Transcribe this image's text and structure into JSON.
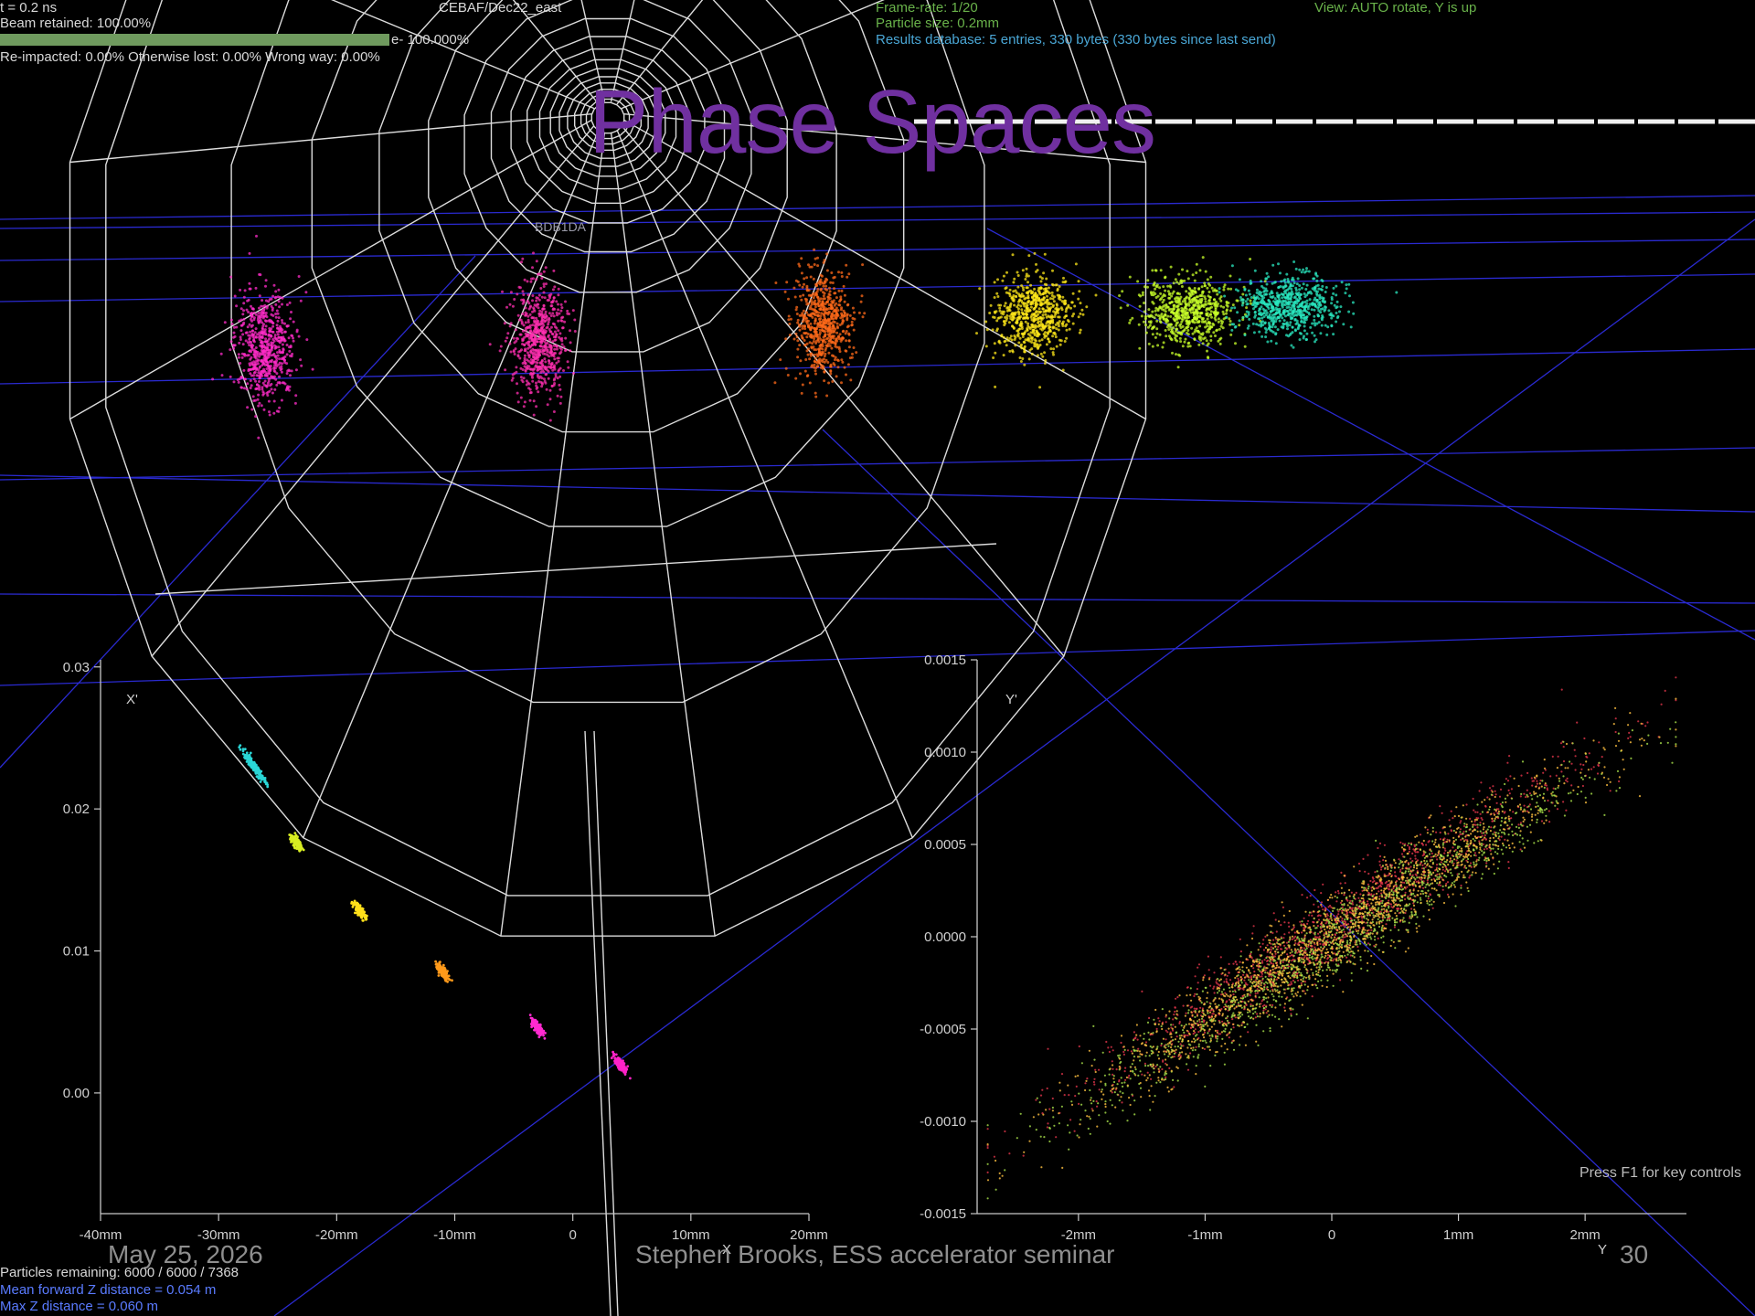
{
  "slide": {
    "title": "Phase Spaces",
    "date": "May 25, 2026",
    "presenter": "Stephen Brooks, ESS accelerator seminar",
    "page_number": "30"
  },
  "hud": {
    "time": "t = 0.2 ns",
    "beam_retained": "Beam retained: 100.00%",
    "beam_retained_fraction": 1.0,
    "electron_pct": "e- 100.000%",
    "loss_line": "Re-impacted: 0.00%   Otherwise lost: 0.00%   Wrong way: 0.00%",
    "lattice_name": "CEBAF/Dec22_east",
    "frame_rate": "Frame-rate: 1/20",
    "particle_size": "Particle size: 0.2mm",
    "results_db": "Results database: 5 entries, 330 bytes (330 bytes since last send)",
    "view": "View: AUTO rotate, Y is up",
    "element_label": "BDB1DA",
    "particles_remaining": "Particles remaining: 6000 / 6000 / 7368",
    "mean_z": "Mean forward Z distance = 0.054 m",
    "max_z": "Max Z distance = 0.060 m",
    "key_hint": "Press F1 for key controls"
  },
  "colors": {
    "title": "#7030a0",
    "hud_green": "#69b24a",
    "hud_cyan": "#4aa7d6",
    "hud_blue": "#5a7bff",
    "grid_blue": "#2a2ad0",
    "wireframe": "#e0e0e0",
    "bunches": [
      "#ff2cc8",
      "#ff2fb0",
      "#ff6a1a",
      "#ffe81a",
      "#c8ff2a",
      "#2ae8c0"
    ]
  },
  "chart_data": [
    {
      "type": "scatter",
      "xlabel": "X",
      "ylabel": "X'",
      "x_unit": "mm",
      "xlim": [
        -40,
        20
      ],
      "ylim": [
        -0.0085,
        0.0305
      ],
      "x_ticks": [
        -40,
        -30,
        -20,
        -10,
        0,
        10,
        20
      ],
      "x_tick_labels": [
        "-40mm",
        "-30mm",
        "-20mm",
        "-10mm",
        "0",
        "10mm",
        "20mm"
      ],
      "y_ticks": [
        0.0,
        0.01,
        0.02,
        0.03
      ],
      "y_tick_labels": [
        "0.00",
        "0.01",
        "0.02",
        "0.03"
      ],
      "series": [
        {
          "color": "#2ad6d6",
          "x": -27,
          "y": 0.023
        },
        {
          "color": "#d8ee22",
          "x": -23.5,
          "y": 0.0177
        },
        {
          "color": "#ffe01a",
          "x": -18,
          "y": 0.0128
        },
        {
          "color": "#ff9a1a",
          "x": -11,
          "y": 0.0085
        },
        {
          "color": "#ff2ad0",
          "x": -3,
          "y": 0.0046
        },
        {
          "color": "#ff22c8",
          "x": 4,
          "y": 0.002
        }
      ]
    },
    {
      "type": "scatter",
      "xlabel": "Y",
      "ylabel": "Y'",
      "x_unit": "mm",
      "xlim": [
        -2.8,
        2.8
      ],
      "ylim": [
        -0.0015,
        0.0015
      ],
      "x_ticks": [
        -2,
        -1,
        0,
        1,
        2
      ],
      "x_tick_labels": [
        "-2mm",
        "-1mm",
        "0",
        "1mm",
        "2mm"
      ],
      "y_ticks": [
        -0.0015,
        -0.001,
        -0.0005,
        0.0,
        0.0005,
        0.001,
        0.0015
      ],
      "y_tick_labels": [
        "-0.0015",
        "-0.0010",
        "-0.0005",
        "0.0000",
        "0.0005",
        "0.0010",
        "0.0015"
      ],
      "slope": 0.00045,
      "series": [
        {
          "color": "#e0344a",
          "offset": 5e-05
        },
        {
          "color": "#a8e04a",
          "offset": -3e-05
        },
        {
          "color": "#ffc040",
          "offset": 0.0
        }
      ]
    }
  ]
}
